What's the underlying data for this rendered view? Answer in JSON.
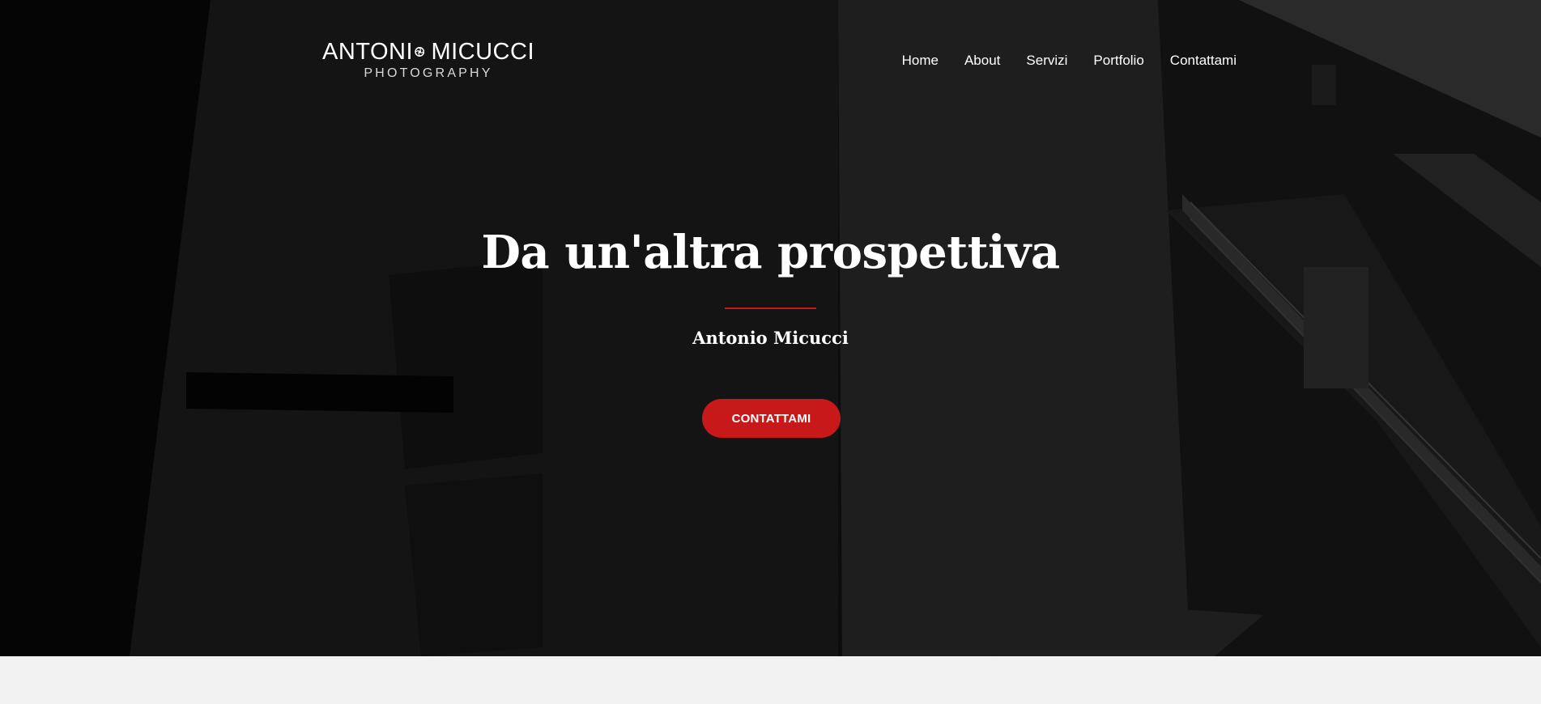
{
  "header": {
    "logo": {
      "name_part1": "ANTONI",
      "name_part2": "MICUCCI",
      "tagline": "PHOTOGRAPHY"
    },
    "nav": [
      {
        "label": "Home"
      },
      {
        "label": "About"
      },
      {
        "label": "Servizi"
      },
      {
        "label": "Portfolio"
      },
      {
        "label": "Contattami"
      }
    ]
  },
  "hero": {
    "title": "Da un'altra prospettiva",
    "subtitle": "Antonio Micucci",
    "cta_label": "CONTATTAMI",
    "accent_color": "#c8191a"
  },
  "icons": {
    "logo_aperture": "camera-aperture-icon"
  },
  "colors": {
    "hero_bg": "#0f0f0f",
    "below_bg": "#f2f2f2",
    "text": "#ffffff"
  }
}
